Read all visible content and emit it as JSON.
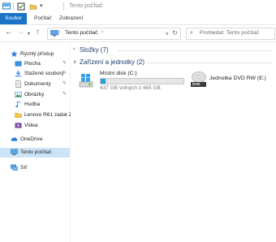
{
  "window": {
    "title": "Tento počítač"
  },
  "ribbon": {
    "tabs": [
      {
        "label": "Soubor",
        "active": true
      },
      {
        "label": "Počítač"
      },
      {
        "label": "Zobrazení"
      }
    ]
  },
  "address": {
    "crumbs": [
      "Tento počítač"
    ],
    "search_placeholder": "Prohledat: Tento počítač"
  },
  "sidebar": {
    "items": [
      {
        "label": "Rychlý přístup",
        "icon": "star-icon"
      },
      {
        "label": "Plocha",
        "icon": "desktop-folder-icon",
        "pinned": true
      },
      {
        "label": "Stažené soubory",
        "icon": "downloads-icon",
        "pinned": true
      },
      {
        "label": "Dokumenty",
        "icon": "documents-icon",
        "pinned": true
      },
      {
        "label": "Obrázky",
        "icon": "pictures-icon",
        "pinned": true
      },
      {
        "label": "Hudba",
        "icon": "music-icon"
      },
      {
        "label": "Lenovo R61 zadat Z",
        "icon": "folder-icon"
      },
      {
        "label": "Videa",
        "icon": "videos-icon"
      },
      {
        "label": "OneDrive",
        "icon": "cloud-icon"
      },
      {
        "label": "Tento počítač",
        "icon": "computer-icon",
        "selected": true
      },
      {
        "label": "Síť",
        "icon": "network-icon"
      }
    ]
  },
  "content": {
    "folders_header": "Složky (7)",
    "devices_header": "Zařízení a jednotky (2)",
    "drives": [
      {
        "name": "Místní disk (C:)",
        "free_text": "437 GB volných z 465 GB",
        "used_fraction": 0.06
      },
      {
        "name": "Jednotka DVD RW (E:)",
        "icon_label": "DVD"
      }
    ]
  },
  "colors": {
    "accent": "#1a73c7",
    "selection": "#cce4f7",
    "header_text": "#1e3b6d",
    "bar_fill": "#26a0da"
  }
}
